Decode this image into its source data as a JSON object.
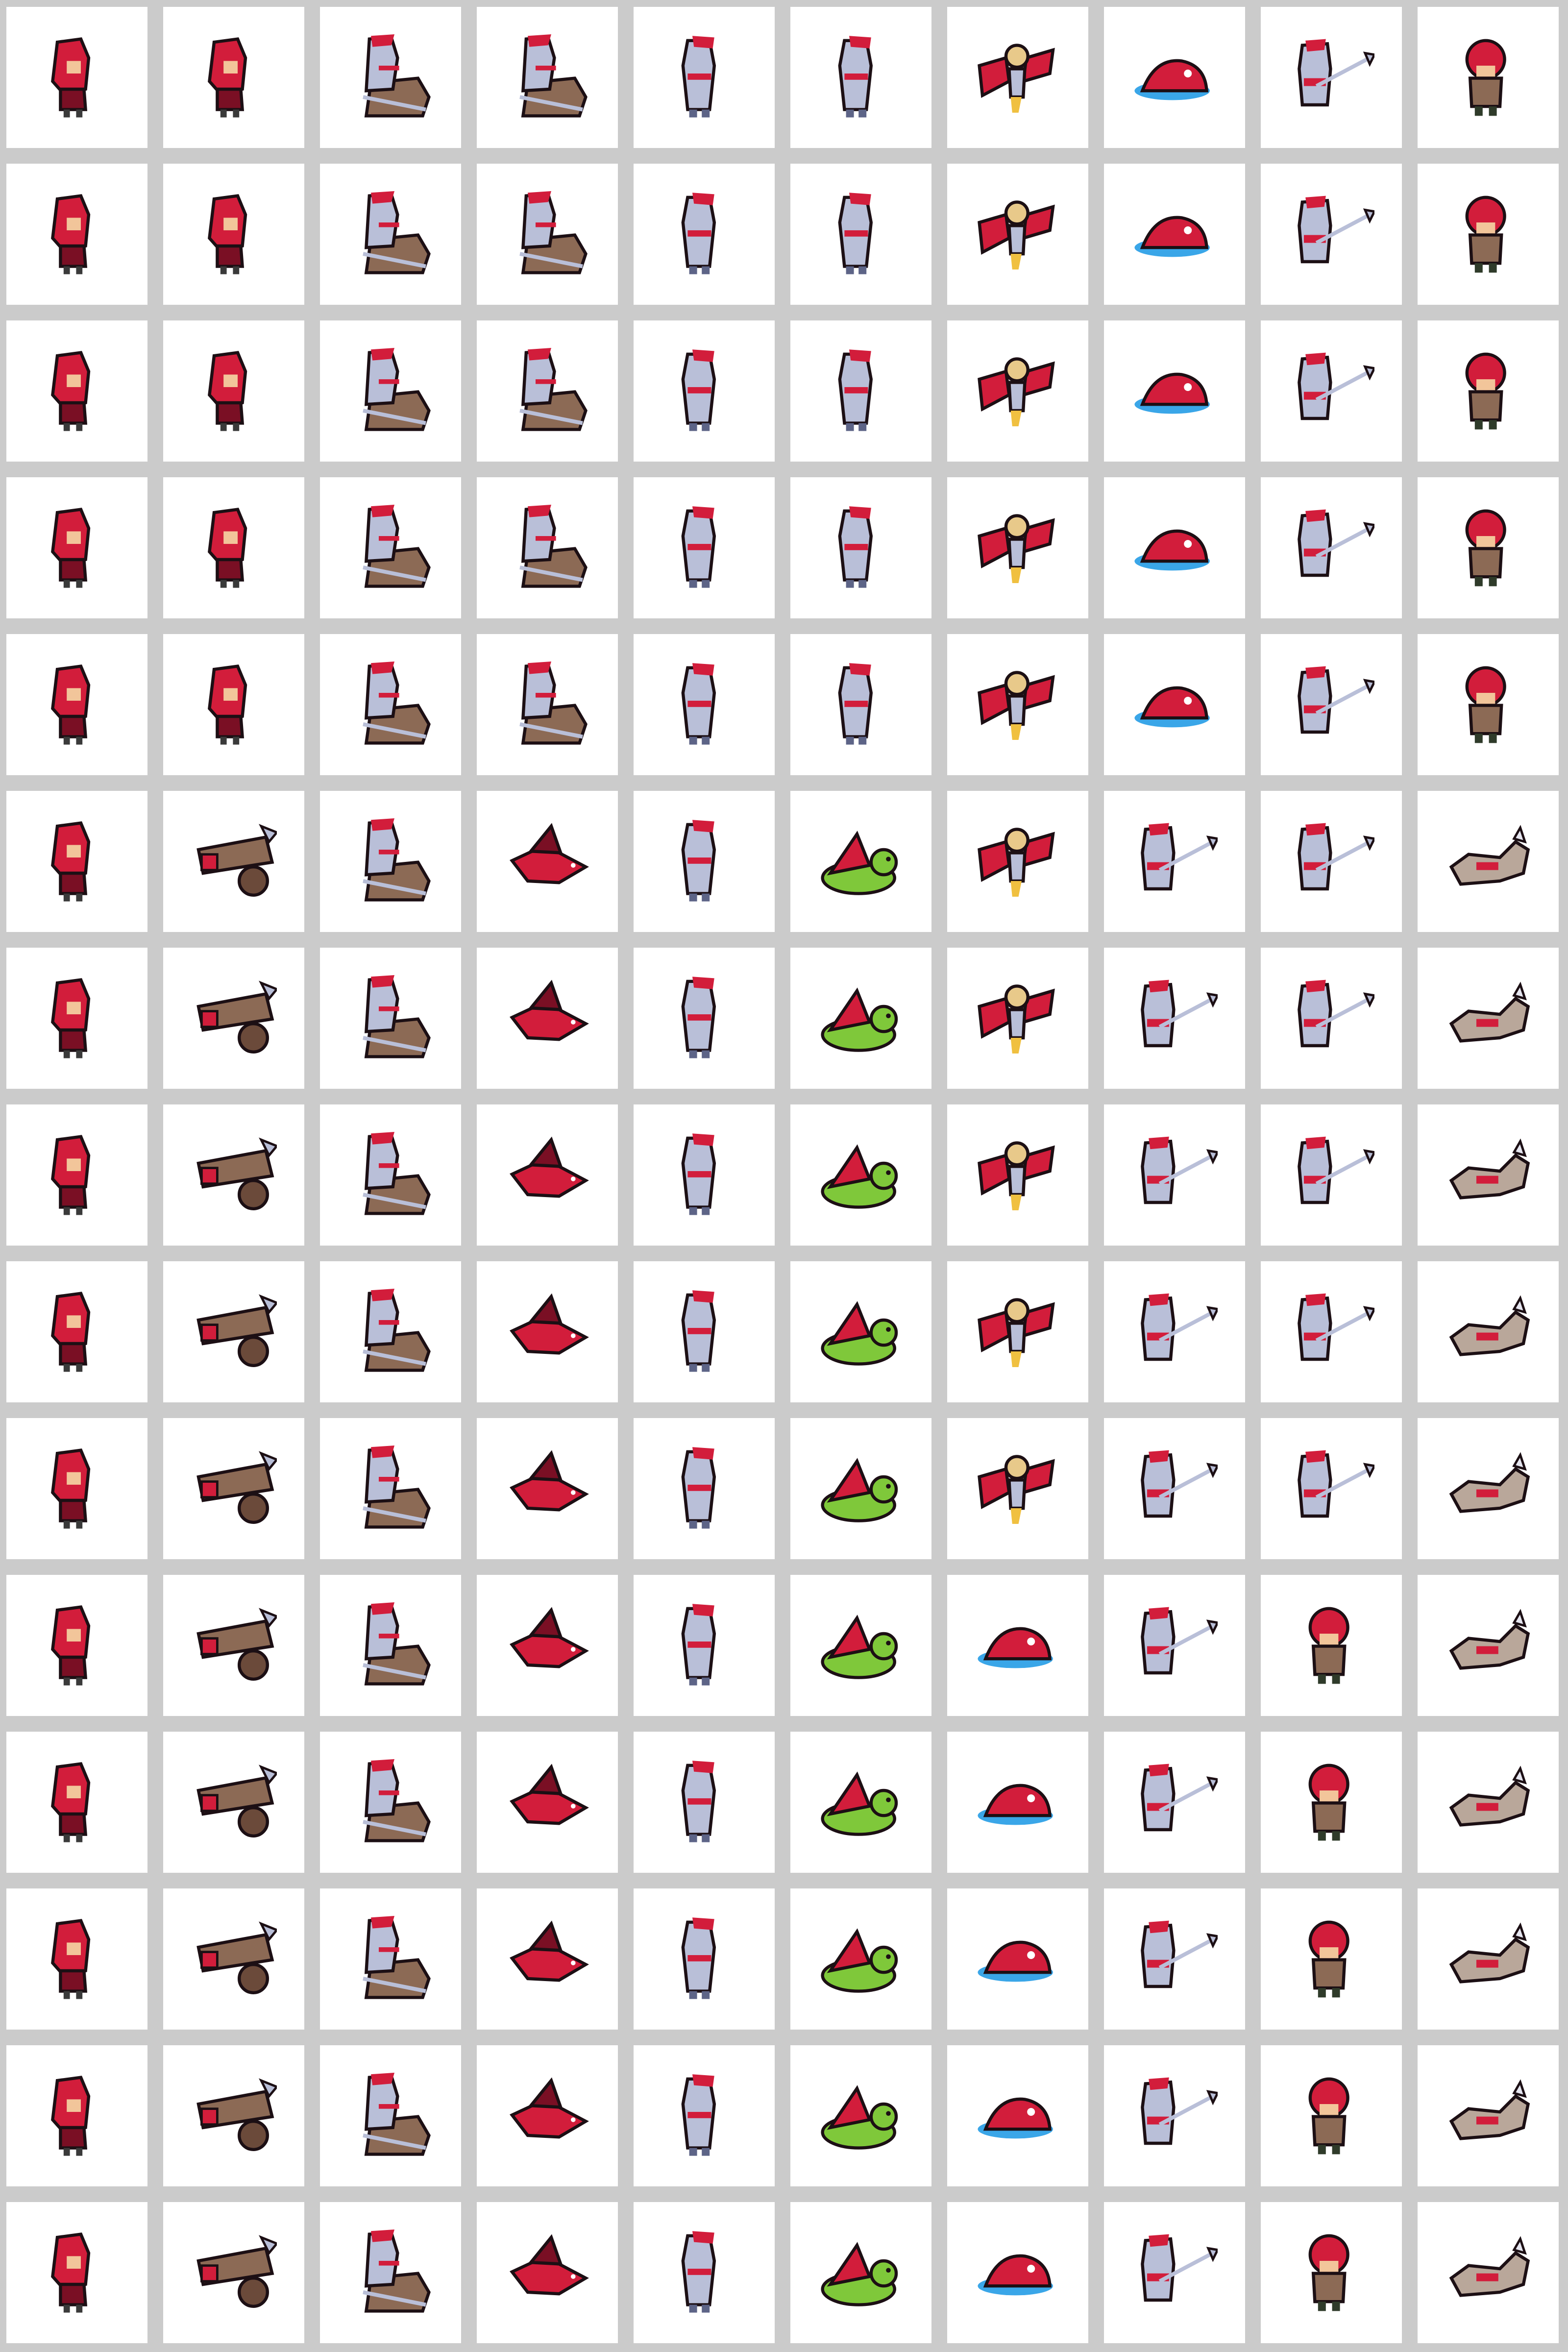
{
  "sheet": {
    "columns": 10,
    "rows": 15,
    "sprites": [
      [
        "hood",
        "hood",
        "knight-mount",
        "knight-mount",
        "knight-shield",
        "knight-shield",
        "harpy",
        "sea-blob",
        "spearman",
        "red-cap"
      ],
      [
        "hood",
        "hood",
        "knight-mount",
        "knight-mount",
        "knight-shield",
        "knight-shield",
        "harpy",
        "sea-blob",
        "spearman",
        "red-cap"
      ],
      [
        "hood",
        "hood",
        "knight-mount",
        "knight-mount",
        "knight-shield",
        "knight-shield",
        "harpy",
        "sea-blob",
        "spearman",
        "red-cap"
      ],
      [
        "hood",
        "hood",
        "knight-mount",
        "knight-mount",
        "knight-shield",
        "knight-shield",
        "harpy",
        "sea-blob",
        "spearman",
        "red-cap"
      ],
      [
        "hood",
        "hood",
        "knight-mount",
        "knight-mount",
        "knight-shield",
        "knight-shield",
        "harpy",
        "sea-blob",
        "spearman",
        "red-cap"
      ],
      [
        "hood",
        "siege-cart",
        "knight-mount",
        "dragon",
        "knight-shield",
        "turtle",
        "harpy",
        "spearman",
        "spearman",
        "wolf"
      ],
      [
        "hood",
        "siege-cart",
        "knight-mount",
        "dragon",
        "knight-shield",
        "turtle",
        "harpy",
        "spearman",
        "spearman",
        "wolf"
      ],
      [
        "hood",
        "siege-cart",
        "knight-mount",
        "dragon",
        "knight-shield",
        "turtle",
        "harpy",
        "spearman",
        "spearman",
        "wolf"
      ],
      [
        "hood",
        "siege-cart",
        "knight-mount",
        "dragon",
        "knight-shield",
        "turtle",
        "harpy",
        "spearman",
        "spearman",
        "wolf"
      ],
      [
        "hood",
        "siege-cart",
        "knight-mount",
        "dragon",
        "knight-shield",
        "turtle",
        "harpy",
        "spearman",
        "spearman",
        "wolf"
      ],
      [
        "hood",
        "siege-cart",
        "knight-mount",
        "dragon",
        "knight-shield",
        "turtle",
        "sea-blob",
        "spearman",
        "red-cap",
        "wolf"
      ],
      [
        "hood",
        "siege-cart",
        "knight-mount",
        "dragon",
        "knight-shield",
        "turtle",
        "sea-blob",
        "spearman",
        "red-cap",
        "wolf"
      ],
      [
        "hood",
        "siege-cart",
        "knight-mount",
        "dragon",
        "knight-shield",
        "turtle",
        "sea-blob",
        "spearman",
        "red-cap",
        "wolf"
      ],
      [
        "hood",
        "siege-cart",
        "knight-mount",
        "dragon",
        "knight-shield",
        "turtle",
        "sea-blob",
        "spearman",
        "red-cap",
        "wolf"
      ],
      [
        "hood",
        "siege-cart",
        "knight-mount",
        "dragon",
        "knight-shield",
        "turtle",
        "sea-blob",
        "spearman",
        "red-cap",
        "wolf"
      ]
    ]
  },
  "colors": {
    "background": "#cbcbcb",
    "cell": "#ffffff",
    "red": "#d21d3b",
    "dark_red": "#7a0f24",
    "armor": "#b9bfd8",
    "armor_dark": "#5d6487",
    "skin": "#f2c59a",
    "brown": "#8c6a55",
    "green": "#7fc83a",
    "water": "#3aa6e8",
    "outline": "#1c0f14"
  }
}
